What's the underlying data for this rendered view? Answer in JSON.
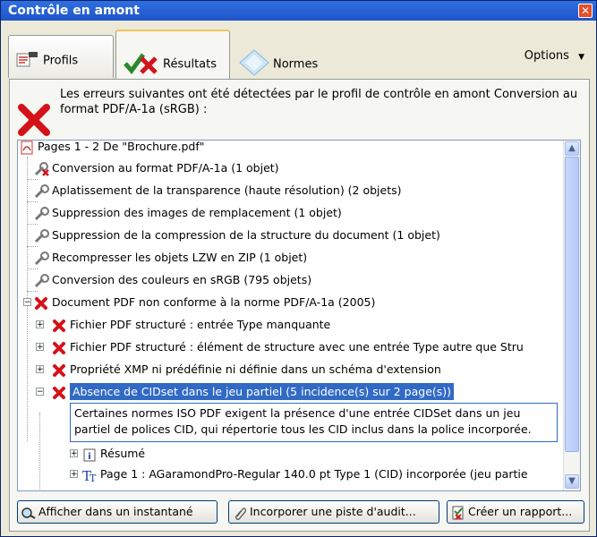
{
  "window": {
    "title": "Contrôle en amont"
  },
  "tabs": [
    {
      "label": "Profils",
      "active": false
    },
    {
      "label": "Résultats",
      "active": true
    },
    {
      "label": "Normes",
      "active": false
    }
  ],
  "options_label": "Options",
  "header": {
    "message": "Les erreurs suivantes ont été détectées par le profil de contrôle en amont Conversion au format PDF/A-1a (sRGB) :"
  },
  "tree": {
    "root": "Pages 1 - 2 De \"Brochure.pdf\"",
    "fixups": [
      {
        "label": "Conversion au format PDF/A-1a (1 objet)",
        "icon": "wrench-error-icon"
      },
      {
        "label": "Aplatissement de la transparence (haute résolution) (2 objets)",
        "icon": "wrench-icon"
      },
      {
        "label": "Suppression des images de remplacement (1 objet)",
        "icon": "wrench-icon"
      },
      {
        "label": "Suppression de la compression de la structure du document (1 objet)",
        "icon": "wrench-icon"
      },
      {
        "label": "Recompresser les objets LZW en ZIP (1 objet)",
        "icon": "wrench-icon"
      },
      {
        "label": "Conversion des couleurs en sRGB (795 objets)",
        "icon": "wrench-icon"
      }
    ],
    "nonconform": "Document PDF non conforme à la norme PDF/A-1a (2005)",
    "errors": [
      {
        "label": "Fichier PDF structuré : entrée Type manquante"
      },
      {
        "label": "Fichier PDF structuré : élément de structure avec une entrée Type autre que Stru"
      },
      {
        "label": "Propriété XMP ni prédéfinie ni définie dans un schéma d'extension"
      },
      {
        "label": "Absence de CIDset dans le jeu partiel (5 incidence(s) sur 2 page(s))"
      }
    ],
    "detail": "Certaines normes ISO PDF exigent la présence d'une entrée CIDSet dans un jeu partiel de polices CID, qui répertorie tous les CID inclus dans la police incorporée.",
    "summary": "Résumé",
    "page_item": "Page 1 : AGaramondPro-Regular 140.0 pt Type 1 (CID)  incorporée (jeu partie"
  },
  "buttons": [
    {
      "label": "Afficher dans un instantané"
    },
    {
      "label": "Incorporer une piste d'audit..."
    },
    {
      "label": "Créer un rapport..."
    }
  ],
  "colors": {
    "titlebar": "#2456c9",
    "selection": "#316ac5",
    "error_red": "#d4121a"
  }
}
